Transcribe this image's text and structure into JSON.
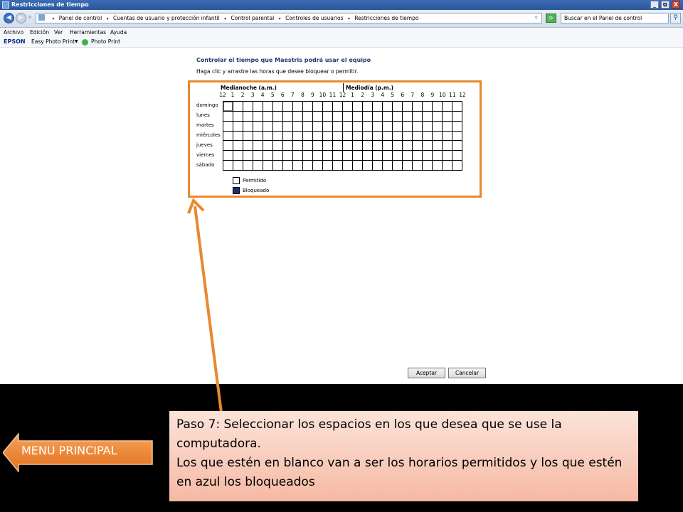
{
  "window": {
    "title": "Restricciones de tiempo",
    "controls": [
      "_",
      "⧉",
      "X"
    ]
  },
  "address": {
    "dropdown": "▾",
    "crumbs": [
      "Panel de control",
      "Cuentas de usuario y protección infantil",
      "Control parental",
      "Controles de usuarios",
      "Restricciones de tiempo"
    ],
    "search_placeholder": "Buscar en el Panel de control"
  },
  "menu": [
    "Archivo",
    "Edición",
    "Ver",
    "Herramientas",
    "Ayuda"
  ],
  "epson": {
    "brand": "EPSON",
    "easy_photo_print": "Easy Photo Print",
    "photo_print": "Photo Print"
  },
  "content": {
    "heading": "Controlar el tiempo que Maestris podrá usar el equipo",
    "instructions": "Haga clic y arrastre las horas que desee bloquear o permitir.",
    "am_label": "Medianoche (a.m.)",
    "pm_label": "Mediodía (p.m.)",
    "hours": [
      "12",
      "1",
      "2",
      "3",
      "4",
      "5",
      "6",
      "7",
      "8",
      "9",
      "10",
      "11",
      "12",
      "1",
      "2",
      "3",
      "4",
      "5",
      "6",
      "7",
      "8",
      "9",
      "10",
      "11",
      "12"
    ],
    "days": [
      "domingo",
      "lunes",
      "martes",
      "miércoles",
      "jueves",
      "viernes",
      "sábado"
    ],
    "legend_allowed": "Permitido",
    "legend_blocked": "Bloqueado",
    "accent_blocked": "#1a2f6b",
    "highlight_color": "#e8892c"
  },
  "buttons": {
    "accept": "Aceptar",
    "cancel": "Cancelar"
  },
  "callout": {
    "line1": "Paso 7: Seleccionar los espacios en los que desea que se use la computadora.",
    "line2": "Los que estén en blanco van a ser los horarios permitidos y los que estén en azul los bloqueados"
  },
  "menu_principal": "MENU PRINCIPAL"
}
